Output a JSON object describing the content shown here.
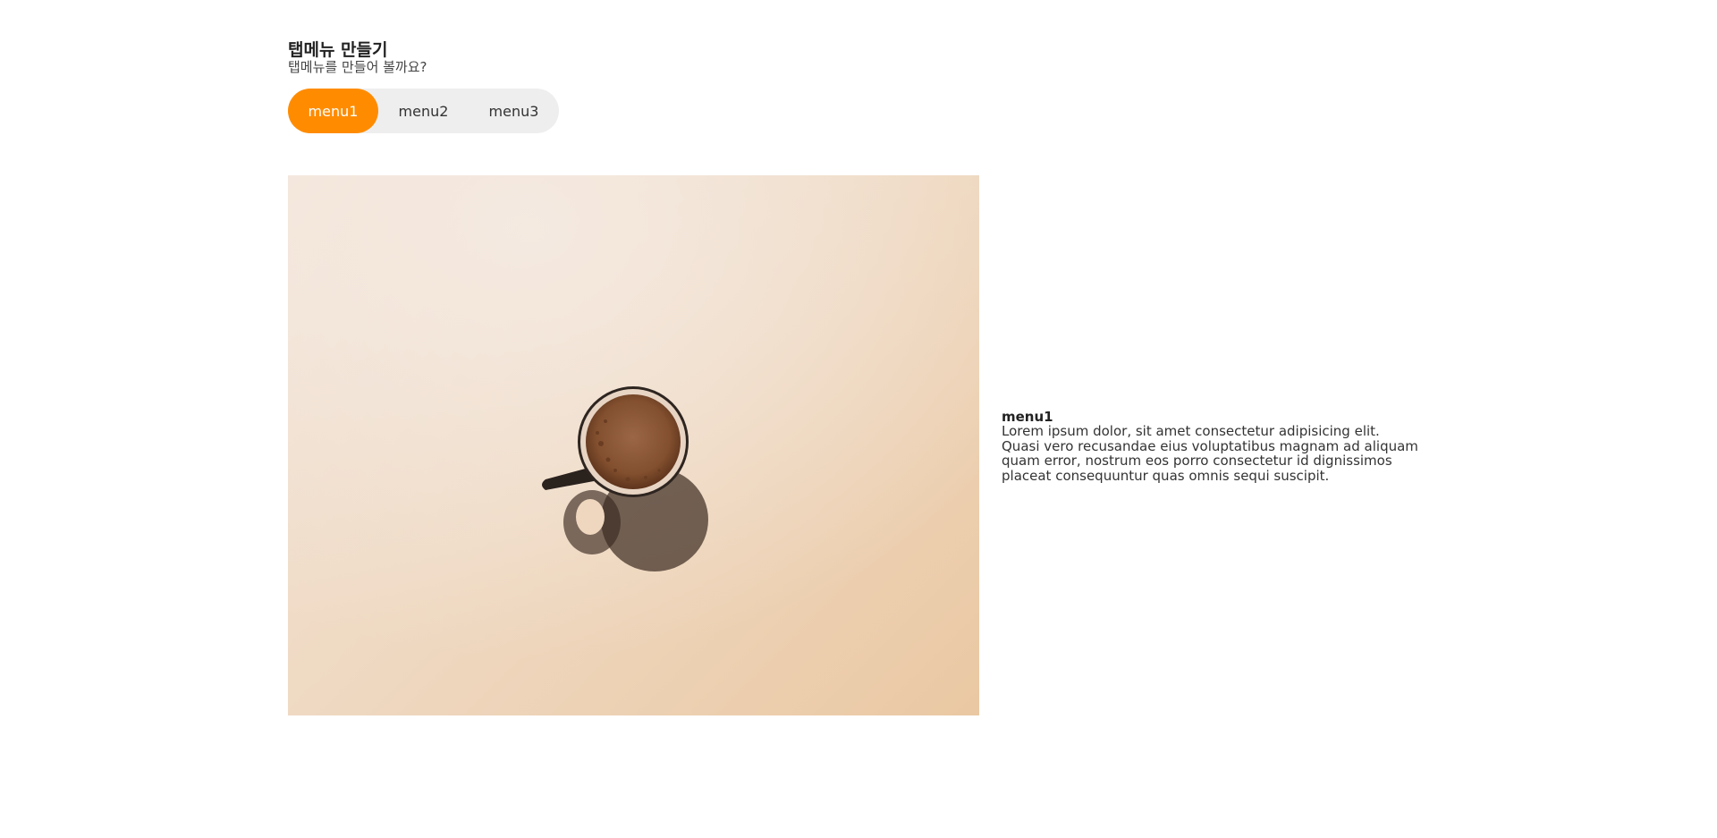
{
  "header": {
    "title": "탭메뉴 만들기",
    "subtitle": "탭메뉴를 만들어 볼까요?"
  },
  "tabs": [
    {
      "label": "menu1",
      "active": true
    },
    {
      "label": "menu2",
      "active": false
    },
    {
      "label": "menu3",
      "active": false
    }
  ],
  "panel": {
    "image_icon": "coffee-cup-photo",
    "title": "menu1",
    "text": "Lorem ipsum dolor, sit amet consectetur adipisicing elit. Quasi vero recusandae eius voluptatibus magnam ad aliquam quam error, nostrum eos porro consectetur id dignissimos placeat consequuntur quas omnis sequi suscipit."
  },
  "colors": {
    "accent": "#ff8c00",
    "tab_bg": "#eeeeee"
  }
}
